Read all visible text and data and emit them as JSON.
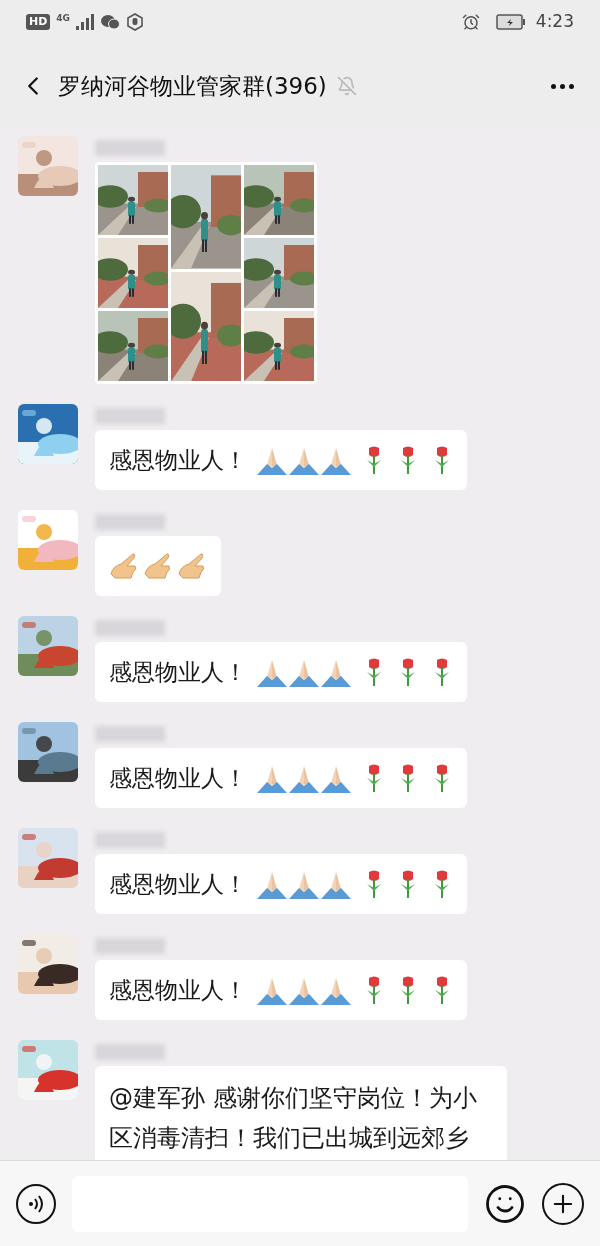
{
  "status_bar": {
    "badge": "HD",
    "network": "4G",
    "time": "4:23"
  },
  "header": {
    "title": "罗纳河谷物业管家群(396)",
    "muted": true
  },
  "messages": [
    {
      "kind": "photos"
    },
    {
      "kind": "greeting",
      "text": "感恩物业人！"
    },
    {
      "kind": "sticker"
    },
    {
      "kind": "greeting",
      "text": "感恩物业人！"
    },
    {
      "kind": "greeting",
      "text": "感恩物业人！"
    },
    {
      "kind": "greeting",
      "text": "感恩物业人！"
    },
    {
      "kind": "greeting",
      "text": "感恩物业人！"
    },
    {
      "kind": "text",
      "text": "@建军孙  感谢你们坚守岗位！为小区消毒清扫！我们已出城到远郊乡"
    }
  ]
}
